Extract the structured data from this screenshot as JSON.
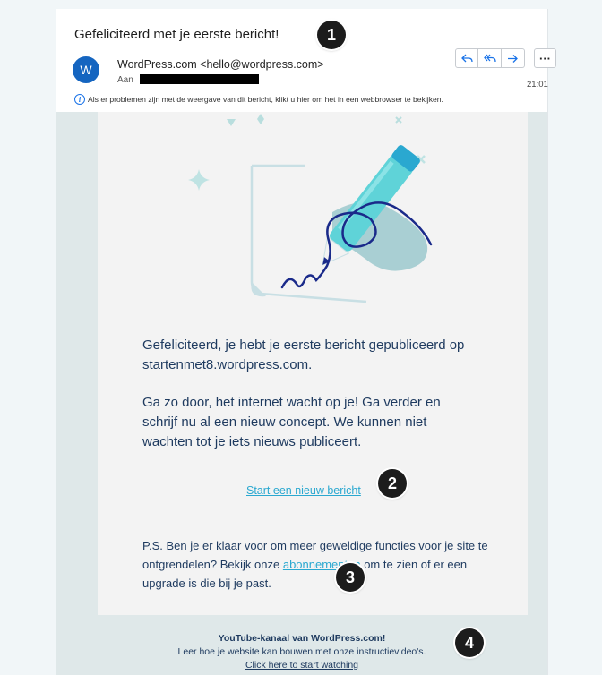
{
  "email": {
    "subject": "Gefeliciteerd met je eerste bericht!",
    "avatar_letter": "W",
    "sender": "WordPress.com <hello@wordpress.com>",
    "to_label": "Aan",
    "time": "21:01",
    "info_icon": "i",
    "info_text": "Als er problemen zijn met de weergave van dit bericht, klikt u hier om het in een webbrowser te bekijken.",
    "actions": {
      "reply_icon": "reply-icon",
      "reply_all_icon": "reply-all-icon",
      "forward_icon": "forward-icon",
      "more_label": "···"
    }
  },
  "content": {
    "para1": "Gefeliciteerd, je hebt je eerste bericht gepubliceerd op startenmet8.wordpress.com.",
    "para2": "Ga zo door, het internet wacht op je! Ga verder en schrijf nu al een nieuw concept. We kunnen niet wachten tot je iets nieuws publiceert.",
    "cta": "Start een nieuw bericht",
    "ps_before": "P.S. Ben je er klaar voor om meer geweldige functies voor je site te ontgrendelen? Bekijk onze ",
    "ps_link": "abonnementen",
    "ps_after": " om te zien of er een upgrade is die bij je past."
  },
  "footer": {
    "title": "YouTube-kanaal van WordPress.com!",
    "line": "Leer hoe je website kan bouwen met onze instructievideo's.",
    "link": "Click here to start watching"
  },
  "badges": [
    "1",
    "2",
    "3",
    "4"
  ],
  "colors": {
    "accent": "#1a73e8",
    "link": "#2aa8d0",
    "text": "#1e3a5f",
    "illustration_teal": "#5fd3d8",
    "illustration_navy": "#1a2a8a"
  }
}
